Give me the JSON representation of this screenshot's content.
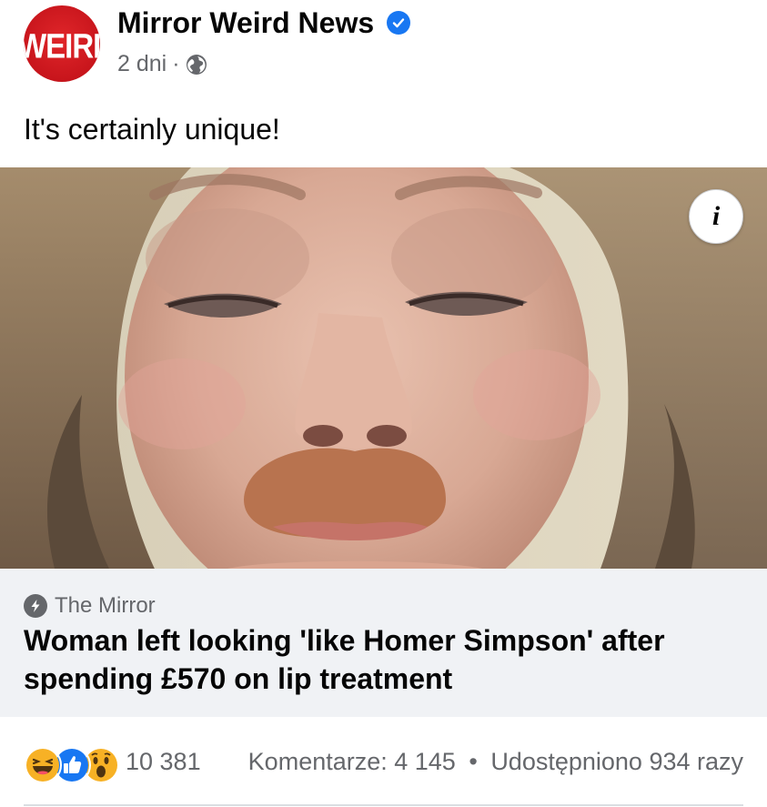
{
  "post": {
    "page_name": "Mirror Weird News",
    "avatar_text": "WEIRD",
    "time": "2 dni",
    "separator": "·",
    "privacy_icon": "globe-icon",
    "verified_icon": "verified-badge-icon",
    "text": "It's certainly unique!"
  },
  "link_preview": {
    "source_icon": "lightning-icon",
    "source": "The Mirror",
    "title": "Woman left looking 'like Homer Simpson' after spending £570 on lip treatment",
    "info_label": "i"
  },
  "engagement": {
    "reaction_icons": [
      "haha-icon",
      "like-icon",
      "wow-icon"
    ],
    "reactions_count": "10 381",
    "comments": "Komentarze: 4 145",
    "bullet": "•",
    "shares": "Udostępniono 934 razy"
  },
  "colors": {
    "accent": "#1877f2",
    "secondary_text": "#65676b",
    "avatar_red": "#d11a20"
  }
}
